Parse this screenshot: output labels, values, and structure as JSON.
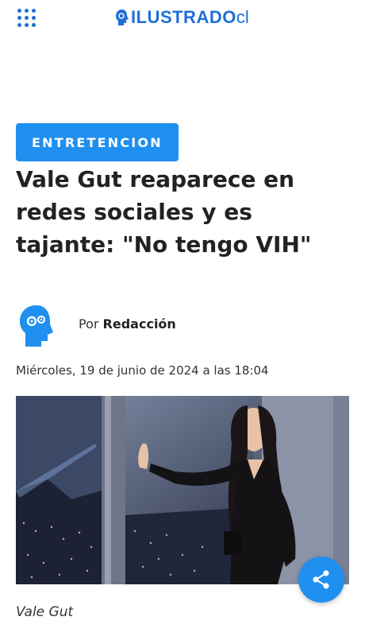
{
  "header": {
    "logo_text": "ILUSTRADO",
    "logo_suffix": "cl",
    "menu_icon": "grid-menu-icon",
    "brand_color": "#1f6fd6"
  },
  "article": {
    "category": "ENTRETENCION",
    "category_color": "#1f8ff0",
    "headline": "Vale Gut reaparece en redes sociales y es tajante: \"No tengo VIH\"",
    "byline_prefix": "Por",
    "author": "Redacción",
    "date": "Miércoles, 19 de junio de 2024 a las 18:04",
    "image_caption": "Vale Gut"
  },
  "actions": {
    "share_icon": "share-icon"
  }
}
